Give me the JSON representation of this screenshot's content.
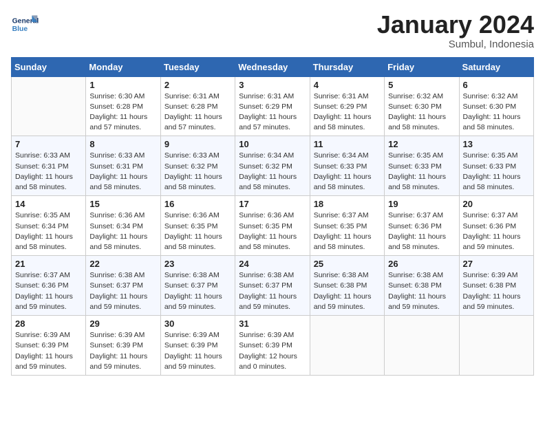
{
  "header": {
    "logo_general": "General",
    "logo_blue": "Blue",
    "month_year": "January 2024",
    "location": "Sumbul, Indonesia"
  },
  "calendar": {
    "days_of_week": [
      "Sunday",
      "Monday",
      "Tuesday",
      "Wednesday",
      "Thursday",
      "Friday",
      "Saturday"
    ],
    "weeks": [
      [
        {
          "day": "",
          "info": ""
        },
        {
          "day": "1",
          "info": "Sunrise: 6:30 AM\nSunset: 6:28 PM\nDaylight: 11 hours\nand 57 minutes."
        },
        {
          "day": "2",
          "info": "Sunrise: 6:31 AM\nSunset: 6:28 PM\nDaylight: 11 hours\nand 57 minutes."
        },
        {
          "day": "3",
          "info": "Sunrise: 6:31 AM\nSunset: 6:29 PM\nDaylight: 11 hours\nand 57 minutes."
        },
        {
          "day": "4",
          "info": "Sunrise: 6:31 AM\nSunset: 6:29 PM\nDaylight: 11 hours\nand 58 minutes."
        },
        {
          "day": "5",
          "info": "Sunrise: 6:32 AM\nSunset: 6:30 PM\nDaylight: 11 hours\nand 58 minutes."
        },
        {
          "day": "6",
          "info": "Sunrise: 6:32 AM\nSunset: 6:30 PM\nDaylight: 11 hours\nand 58 minutes."
        }
      ],
      [
        {
          "day": "7",
          "info": "Sunrise: 6:33 AM\nSunset: 6:31 PM\nDaylight: 11 hours\nand 58 minutes."
        },
        {
          "day": "8",
          "info": "Sunrise: 6:33 AM\nSunset: 6:31 PM\nDaylight: 11 hours\nand 58 minutes."
        },
        {
          "day": "9",
          "info": "Sunrise: 6:33 AM\nSunset: 6:32 PM\nDaylight: 11 hours\nand 58 minutes."
        },
        {
          "day": "10",
          "info": "Sunrise: 6:34 AM\nSunset: 6:32 PM\nDaylight: 11 hours\nand 58 minutes."
        },
        {
          "day": "11",
          "info": "Sunrise: 6:34 AM\nSunset: 6:33 PM\nDaylight: 11 hours\nand 58 minutes."
        },
        {
          "day": "12",
          "info": "Sunrise: 6:35 AM\nSunset: 6:33 PM\nDaylight: 11 hours\nand 58 minutes."
        },
        {
          "day": "13",
          "info": "Sunrise: 6:35 AM\nSunset: 6:33 PM\nDaylight: 11 hours\nand 58 minutes."
        }
      ],
      [
        {
          "day": "14",
          "info": "Sunrise: 6:35 AM\nSunset: 6:34 PM\nDaylight: 11 hours\nand 58 minutes."
        },
        {
          "day": "15",
          "info": "Sunrise: 6:36 AM\nSunset: 6:34 PM\nDaylight: 11 hours\nand 58 minutes."
        },
        {
          "day": "16",
          "info": "Sunrise: 6:36 AM\nSunset: 6:35 PM\nDaylight: 11 hours\nand 58 minutes."
        },
        {
          "day": "17",
          "info": "Sunrise: 6:36 AM\nSunset: 6:35 PM\nDaylight: 11 hours\nand 58 minutes."
        },
        {
          "day": "18",
          "info": "Sunrise: 6:37 AM\nSunset: 6:35 PM\nDaylight: 11 hours\nand 58 minutes."
        },
        {
          "day": "19",
          "info": "Sunrise: 6:37 AM\nSunset: 6:36 PM\nDaylight: 11 hours\nand 58 minutes."
        },
        {
          "day": "20",
          "info": "Sunrise: 6:37 AM\nSunset: 6:36 PM\nDaylight: 11 hours\nand 59 minutes."
        }
      ],
      [
        {
          "day": "21",
          "info": "Sunrise: 6:37 AM\nSunset: 6:36 PM\nDaylight: 11 hours\nand 59 minutes."
        },
        {
          "day": "22",
          "info": "Sunrise: 6:38 AM\nSunset: 6:37 PM\nDaylight: 11 hours\nand 59 minutes."
        },
        {
          "day": "23",
          "info": "Sunrise: 6:38 AM\nSunset: 6:37 PM\nDaylight: 11 hours\nand 59 minutes."
        },
        {
          "day": "24",
          "info": "Sunrise: 6:38 AM\nSunset: 6:37 PM\nDaylight: 11 hours\nand 59 minutes."
        },
        {
          "day": "25",
          "info": "Sunrise: 6:38 AM\nSunset: 6:38 PM\nDaylight: 11 hours\nand 59 minutes."
        },
        {
          "day": "26",
          "info": "Sunrise: 6:38 AM\nSunset: 6:38 PM\nDaylight: 11 hours\nand 59 minutes."
        },
        {
          "day": "27",
          "info": "Sunrise: 6:39 AM\nSunset: 6:38 PM\nDaylight: 11 hours\nand 59 minutes."
        }
      ],
      [
        {
          "day": "28",
          "info": "Sunrise: 6:39 AM\nSunset: 6:39 PM\nDaylight: 11 hours\nand 59 minutes."
        },
        {
          "day": "29",
          "info": "Sunrise: 6:39 AM\nSunset: 6:39 PM\nDaylight: 11 hours\nand 59 minutes."
        },
        {
          "day": "30",
          "info": "Sunrise: 6:39 AM\nSunset: 6:39 PM\nDaylight: 11 hours\nand 59 minutes."
        },
        {
          "day": "31",
          "info": "Sunrise: 6:39 AM\nSunset: 6:39 PM\nDaylight: 12 hours\nand 0 minutes."
        },
        {
          "day": "",
          "info": ""
        },
        {
          "day": "",
          "info": ""
        },
        {
          "day": "",
          "info": ""
        }
      ]
    ]
  }
}
